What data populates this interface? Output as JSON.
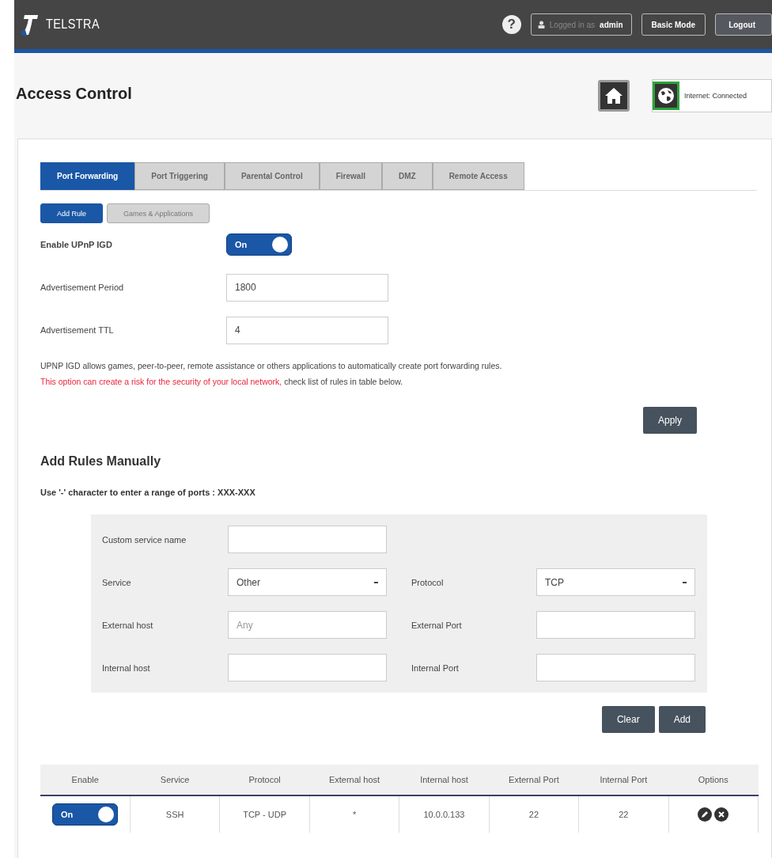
{
  "header": {
    "logo_text": "TELSTRA",
    "help": "?",
    "login": {
      "prefix": "Logged in as",
      "user": "admin"
    },
    "buttons": [
      "Basic Mode",
      "Logout"
    ]
  },
  "page_title": "Access Control",
  "internet_status": "Internet: Connected",
  "tabs": [
    {
      "label": "Port Forwarding",
      "selected": true
    },
    {
      "label": "Port Triggering",
      "selected": false
    },
    {
      "label": "Parental Control",
      "selected": false
    },
    {
      "label": "Firewall",
      "selected": false
    },
    {
      "label": "DMZ",
      "selected": false
    },
    {
      "label": "Remote Access",
      "selected": false
    }
  ],
  "subtabs": [
    {
      "label": "Add Rule",
      "selected": true
    },
    {
      "label": "Games & Applications",
      "selected": false
    }
  ],
  "upnp": {
    "label": "Enable UPnP IGD",
    "switch_label": "On",
    "on": true
  },
  "upnp_fields": [
    {
      "label": "Advertisement Period",
      "value": "1800"
    },
    {
      "label": "Advertisement TTL",
      "value": "4"
    }
  ],
  "description": [
    {
      "kind": "normal",
      "text": "UPNP IGD allows games, peer-to-peer, remote assistance or others applications to automatically create port forwarding rules. "
    },
    {
      "kind": "warning",
      "text": "This option can create a risk for the security of your local network,"
    },
    {
      "kind": "normal",
      "text": " check list of rules in table below."
    }
  ],
  "apply_button": "Apply",
  "manual": {
    "title": "Add Rules Manually",
    "hint": "Use '-' character to enter a range of ports : XXX-XXX",
    "rows": [
      [
        {
          "label": "Custom service name",
          "kind": "text"
        }
      ],
      [
        {
          "label": "Service",
          "kind": "select",
          "value": "Other"
        },
        {
          "label": "Protocol",
          "kind": "select",
          "value": "TCP"
        }
      ],
      [
        {
          "label": "External host",
          "kind": "text",
          "placeholder": "Any"
        },
        {
          "label": "External Port",
          "kind": "text"
        }
      ],
      [
        {
          "label": "Internal host",
          "kind": "text"
        },
        {
          "label": "Internal Port",
          "kind": "text"
        }
      ]
    ],
    "buttons": [
      "Clear",
      "Add"
    ]
  },
  "table": {
    "columns": [
      "Enable",
      "Service",
      "Protocol",
      "External host",
      "Internal host",
      "External Port",
      "Internal Port",
      "Options"
    ],
    "rows": [
      {
        "cells": [
          {
            "kind": "switch",
            "on": true,
            "text": "On"
          },
          {
            "kind": "text",
            "text": "SSH"
          },
          {
            "kind": "text",
            "text": "TCP - UDP"
          },
          {
            "kind": "text",
            "text": "*"
          },
          {
            "kind": "text",
            "text": "10.0.0.133"
          },
          {
            "kind": "text",
            "text": "22"
          },
          {
            "kind": "text",
            "text": "22"
          },
          {
            "kind": "actions"
          }
        ]
      }
    ]
  }
}
